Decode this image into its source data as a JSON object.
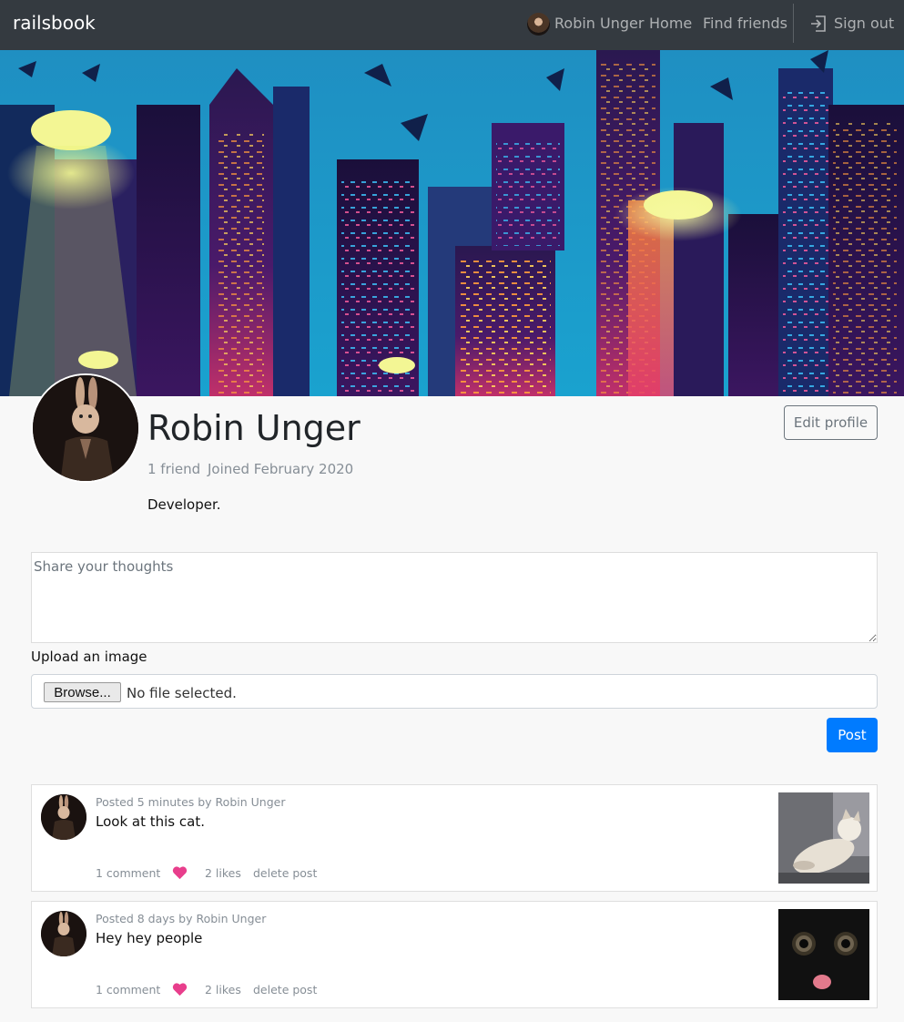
{
  "navbar": {
    "brand": "railsbook",
    "user_name": "Robin Unger",
    "home": "Home",
    "find_friends": "Find friends",
    "sign_out": "Sign out"
  },
  "profile": {
    "name": "Robin Unger",
    "friends": "1 friend",
    "joined": "Joined February 2020",
    "bio": "Developer.",
    "edit_button": "Edit profile"
  },
  "post_form": {
    "placeholder": "Share your thoughts",
    "upload_label": "Upload an image",
    "browse_button": "Browse...",
    "file_status": "No file selected.",
    "post_button": "Post"
  },
  "posts": [
    {
      "posted": "Posted 5 minutes by Robin Unger",
      "body": "Look at this cat.",
      "comments": "1 comment",
      "likes": "2 likes",
      "delete": "delete post"
    },
    {
      "posted": "Posted 8 days by Robin Unger",
      "body": "Hey hey people",
      "comments": "1 comment",
      "likes": "2 likes",
      "delete": "delete post"
    }
  ],
  "colors": {
    "navbar": "#343a40",
    "primary": "#007bff",
    "heart": "#e83e8c",
    "muted": "#868e96"
  }
}
